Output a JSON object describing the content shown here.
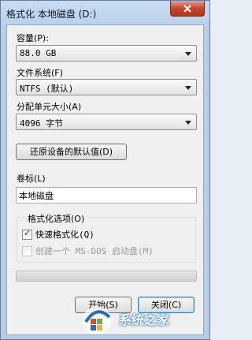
{
  "window": {
    "title": "格式化 本地磁盘 (D:)"
  },
  "capacity": {
    "label": "容量(P):",
    "value": "88.0 GB"
  },
  "filesystem": {
    "label": "文件系统(F)",
    "value": "NTFS (默认)"
  },
  "allocation": {
    "label": "分配单元大小(A)",
    "value": "4096 字节"
  },
  "restore_button": "还原设备的默认值(D)",
  "volume": {
    "label": "卷标(L)",
    "value": "本地磁盘"
  },
  "format_options": {
    "legend": "格式化选项(O)",
    "quick_format": {
      "label": "快速格式化(Q)",
      "checked": true
    },
    "msdos_disk": {
      "label": "创建一个 MS-DOS 启动盘(M)",
      "checked": false,
      "disabled": true
    }
  },
  "progress": {
    "fraction": 0.0
  },
  "buttons": {
    "start": "开始(S)",
    "close": "关闭(C)"
  },
  "watermark": {
    "text": "系统之家"
  },
  "colors": {
    "progress_fill": "#37b34a",
    "close_red": "#c7452f"
  }
}
